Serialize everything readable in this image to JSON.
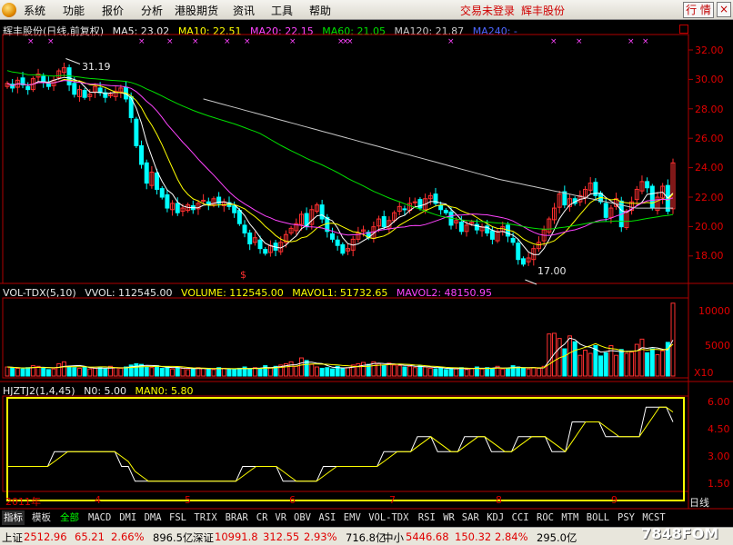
{
  "menu": {
    "items": [
      "系统",
      "功能",
      "报价",
      "分析",
      "港股期货",
      "资讯",
      "工具",
      "帮助"
    ],
    "status_login": "交易未登录",
    "status_stock": "辉丰股份",
    "hq_button": "行 情",
    "close_button": "×"
  },
  "main_info": {
    "stock": "辉丰股份(日线,前复权)",
    "ma5": "MA5: 23.02",
    "ma10": "MA10: 22.51",
    "ma20": "MA20: 22.15",
    "ma60": "MA60: 21.05",
    "ma120": "MA120: 21.87",
    "ma240": "MA240: -"
  },
  "price_axis": [
    "32.00",
    "30.00",
    "28.00",
    "26.00",
    "24.00",
    "22.00",
    "20.00",
    "18.00"
  ],
  "annotations": {
    "high": "31.19",
    "low": "17.00"
  },
  "vol_info": {
    "name": "VOL-TDX(5,10)",
    "vvol": "VVOL: 112545.00",
    "volume": "VOLUME: 112545.00",
    "mavol1": "MAVOL1: 51732.65",
    "mavol2": "MAVOL2: 48150.95"
  },
  "vol_axis": [
    "10000",
    "5000"
  ],
  "vol_unit": "X10",
  "ind_info": {
    "name": "HJZTJ2(1,4,45)",
    "n0": "N0: 5.00",
    "man0": "MAN0: 5.80"
  },
  "ind_axis": [
    "6.00",
    "4.50",
    "3.00",
    "1.50"
  ],
  "date_axis": {
    "start": "2011年",
    "ticks": [
      "4",
      "5",
      "6",
      "7",
      "8",
      "9"
    ]
  },
  "period": "日线",
  "tabs": [
    "指标",
    "模板",
    "全部",
    "MACD",
    "DMI",
    "DMA",
    "FSL",
    "TRIX",
    "BRAR",
    "CR",
    "VR",
    "OBV",
    "ASI",
    "EMV",
    "VOL-TDX",
    "RSI",
    "WR",
    "SAR",
    "KDJ",
    "CCI",
    "ROC",
    "MTM",
    "BOLL",
    "PSY",
    "MCST"
  ],
  "statusbar": {
    "sh_label": "上证",
    "sh_price": "2512.96",
    "sh_chg": "65.21",
    "sh_pct": "2.66%",
    "sh_amt": "896.5亿",
    "sz_label": "深证",
    "sz_price": "10991.8",
    "sz_chg": "312.55",
    "sz_pct": "2.93%",
    "sz_amt": "716.8亿",
    "zx_label": "中小",
    "zx_price": "5446.68",
    "zx_chg": "150.32",
    "zx_pct": "2.84%",
    "zx_amt": "295.0亿"
  },
  "watermark": "7848FOM",
  "colors": {
    "up": "#ff3030",
    "down": "#00ffff",
    "ma5": "#ffffff",
    "ma10": "#ffff00",
    "ma20": "#ff44ff",
    "ma60": "#00e000",
    "ma120": "#c8c8c8",
    "frame": "#b00000",
    "highlight": "#ffff00"
  },
  "chart_data": [
    {
      "type": "candlestick",
      "title": "辉丰股份(日线,前复权)",
      "ylim": [
        17,
        32.5
      ],
      "annotations": [
        {
          "label": "31.19",
          "value": 31.19
        },
        {
          "label": "17.00",
          "value": 17.0
        }
      ],
      "series": [
        {
          "name": "MA5",
          "last": 23.02
        },
        {
          "name": "MA10",
          "last": 22.51
        },
        {
          "name": "MA20",
          "last": 22.15
        },
        {
          "name": "MA60",
          "last": 21.05
        },
        {
          "name": "MA120",
          "last": 21.87
        }
      ],
      "closes": [
        29.6,
        29.3,
        29.8,
        29.5,
        29.2,
        29.9,
        30.2,
        29.7,
        29.4,
        29.8,
        30.4,
        30.6,
        29.5,
        28.9,
        29.2,
        28.7,
        28.9,
        29.4,
        29.0,
        28.7,
        28.9,
        29.1,
        29.3,
        28.6,
        27.4,
        25.6,
        24.4,
        23.2,
        23.9,
        22.8,
        22.3,
        21.6,
        21.9,
        21.3,
        21.6,
        21.8,
        21.5,
        21.9,
        22.1,
        21.8,
        22.2,
        21.9,
        22.0,
        21.7,
        21.3,
        20.6,
        20.0,
        19.3,
        19.7,
        19.0,
        18.7,
        19.2,
        18.9,
        19.4,
        19.9,
        20.3,
        20.6,
        21.2,
        20.4,
        21.5,
        21.8,
        20.9,
        20.1,
        19.6,
        19.2,
        18.7,
        19.0,
        19.6,
        20.0,
        20.2,
        19.7,
        20.4,
        20.9,
        20.4,
        20.8,
        21.3,
        21.7,
        21.5,
        21.9,
        22.0,
        21.6,
        22.2,
        22.4,
        21.9,
        21.5,
        21.3,
        20.5,
        20.8,
        20.1,
        20.5,
        20.7,
        20.2,
        20.4,
        20.0,
        19.6,
        20.1,
        20.4,
        19.8,
        19.4,
        18.3,
        18.0,
        18.4,
        19.0,
        19.4,
        20.2,
        20.9,
        21.6,
        22.5,
        21.8,
        22.2,
        21.9,
        22.4,
        22.8,
        23.2,
        22.4,
        22.0,
        21.0,
        21.6,
        22.2,
        20.4,
        21.4,
        22.0,
        22.8,
        23.3,
        22.9,
        21.6,
        22.3,
        23.0,
        21.4,
        24.5
      ],
      "volumes": [
        1400,
        1300,
        1200,
        1100,
        1300,
        1600,
        1500,
        1200,
        1000,
        1100,
        1900,
        2200,
        1500,
        1300,
        1200,
        1400,
        1100,
        1200,
        1300,
        1100,
        1500,
        1300,
        1200,
        1400,
        1700,
        1900,
        1800,
        1400,
        1300,
        1600,
        1200,
        1400,
        1100,
        1300,
        1200,
        1000,
        1100,
        1300,
        1200,
        1100,
        1000,
        1300,
        1200,
        1100,
        1000,
        1200,
        1400,
        1100,
        1300,
        1200,
        1600,
        1300,
        1500,
        1700,
        1900,
        2200,
        1500,
        2800,
        2400,
        1800,
        1400,
        1200,
        1300,
        1100,
        1500,
        1200,
        1300,
        1700,
        1900,
        2100,
        1800,
        2200,
        1900,
        1600,
        2000,
        1700,
        1600,
        1400,
        1500,
        1300,
        1600,
        1400,
        1200,
        1100,
        1300,
        1000,
        1200,
        1100,
        1300,
        1000,
        1200,
        1400,
        1100,
        1300,
        1200,
        1500,
        1100,
        1200,
        1600,
        1400,
        1200,
        1100,
        1300,
        1200,
        1500,
        6500,
        6600,
        5800,
        4200,
        6200,
        5300,
        3200,
        4000,
        3500,
        4700,
        3100,
        3600,
        4700,
        3200,
        4100,
        3500,
        3700,
        4900,
        5700,
        3600,
        4200,
        3300,
        3900,
        5200,
        11254
      ],
      "ylim_vol": [
        0,
        11500
      ]
    },
    {
      "type": "line",
      "title": "HJZTJ2(1,4,45)",
      "ylim": [
        0.5,
        6.5
      ],
      "series": [
        {
          "name": "N0",
          "last": 5.0
        },
        {
          "name": "MAN0",
          "last": 5.8
        }
      ],
      "values": [
        2,
        2,
        2,
        2,
        2,
        2,
        2,
        3,
        3,
        3,
        3,
        3,
        3,
        3,
        3,
        3,
        3,
        2,
        2,
        1,
        1,
        1,
        1,
        1,
        1,
        1,
        1,
        1,
        1,
        1,
        1,
        1,
        1,
        1,
        1,
        2,
        2,
        2,
        2,
        2,
        2,
        1,
        1,
        1,
        1,
        1,
        1,
        2,
        2,
        2,
        2,
        2,
        2,
        2,
        2,
        2,
        3,
        3,
        3,
        3,
        3,
        4,
        4,
        4,
        3,
        3,
        3,
        3,
        4,
        4,
        4,
        4,
        3,
        3,
        3,
        3,
        4,
        4,
        4,
        4,
        4,
        3,
        3,
        3,
        5,
        5,
        5,
        5,
        5,
        4,
        4,
        4,
        4,
        4,
        4,
        6,
        6,
        6,
        6,
        5
      ]
    }
  ]
}
